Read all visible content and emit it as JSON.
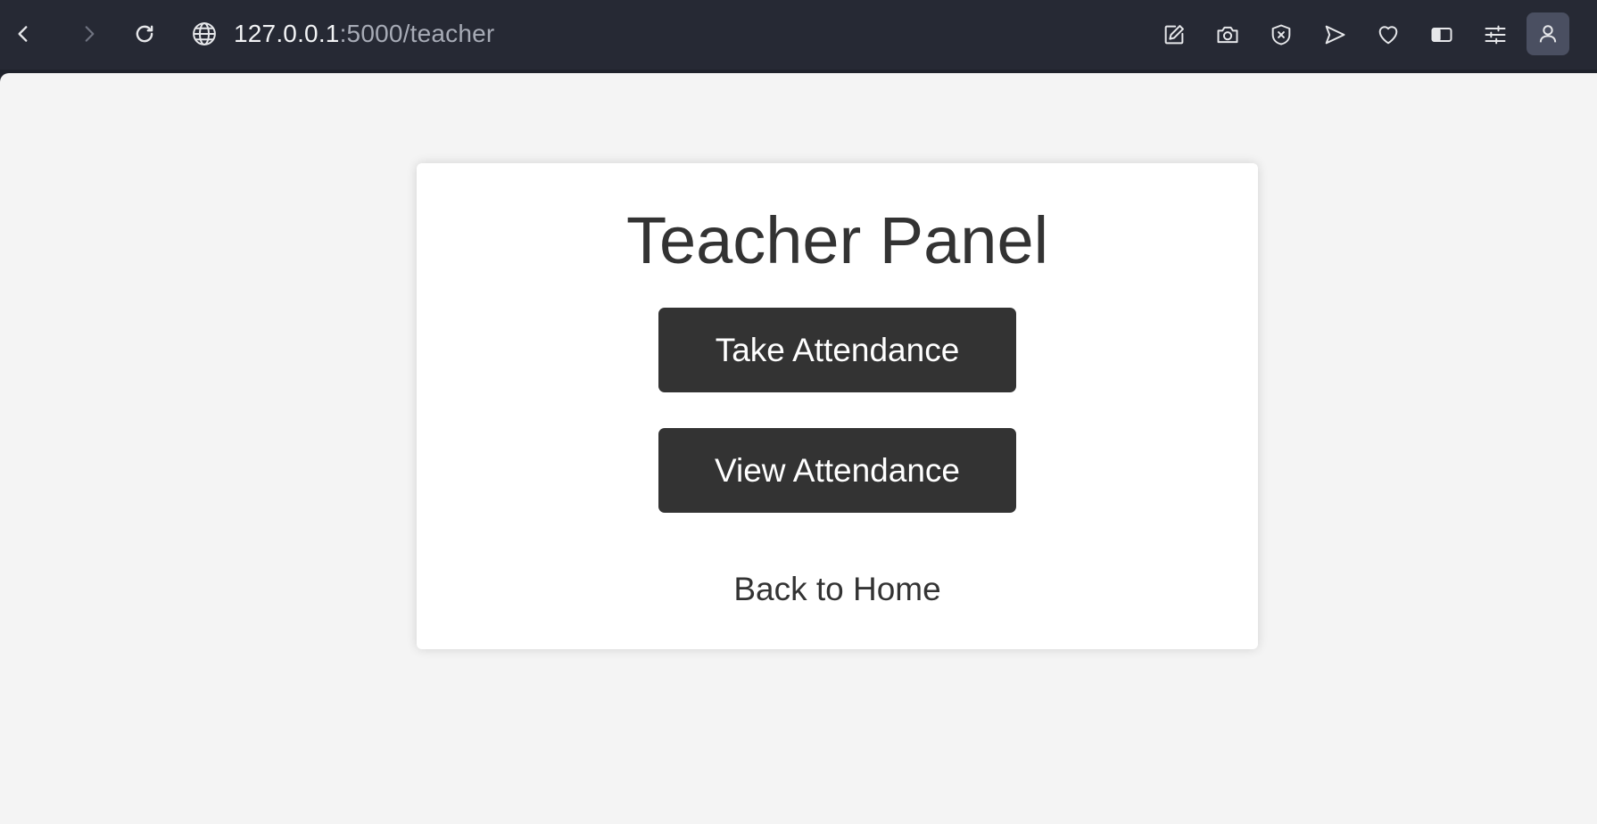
{
  "browser": {
    "url_host": "127.0.0.1",
    "url_path": ":5000/teacher",
    "icons": [
      "back-icon",
      "forward-icon",
      "reload-icon",
      "globe-icon",
      "edit-icon",
      "camera-icon",
      "shield-icon",
      "send-icon",
      "heart-icon",
      "sidebar-icon",
      "settings-sliders-icon",
      "profile-icon"
    ]
  },
  "page": {
    "title": "Teacher Panel",
    "take_attendance_label": "Take Attendance",
    "view_attendance_label": "View Attendance",
    "back_home_label": "Back to Home"
  },
  "colors": {
    "browser_bar": "#262934",
    "page_background": "#f4f4f4",
    "card_background": "#ffffff",
    "button_background": "#333333",
    "text": "#333333"
  }
}
